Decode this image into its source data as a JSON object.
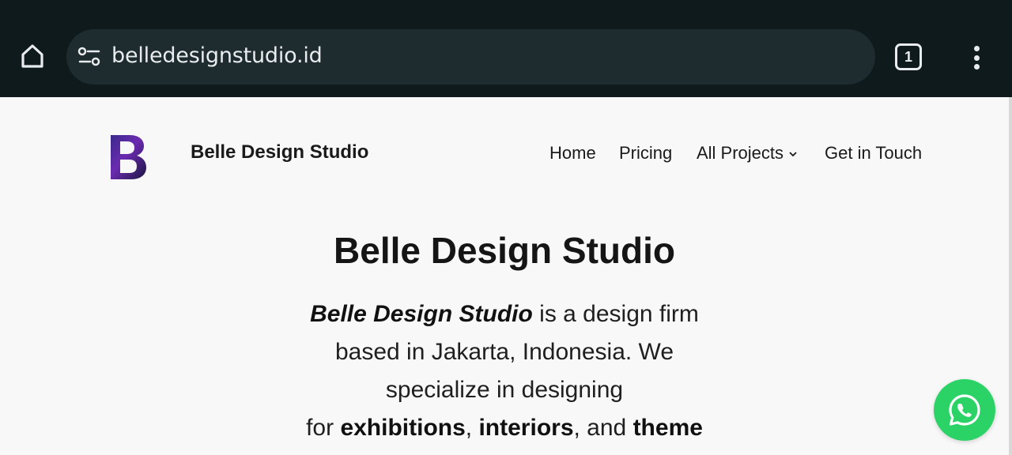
{
  "browser": {
    "url": "belledesignstudio.id",
    "tab_count": "1",
    "home_icon": "home-icon",
    "site_info_icon": "site-settings-icon",
    "menu_icon": "more-vert-icon"
  },
  "header": {
    "logo_letter": "B",
    "site_title": "Belle Design Studio",
    "nav": {
      "home": "Home",
      "pricing": "Pricing",
      "all_projects": "All Projects",
      "get_in_touch": "Get in Touch"
    }
  },
  "hero": {
    "title": "Belle Design Studio",
    "desc_brand": "Belle Design Studio",
    "desc_line1_rest": " is a design firm",
    "desc_line2": "based in Jakarta, Indonesia. We",
    "desc_line3": "specialize in designing",
    "desc_for": "for ",
    "desc_exhibitions": "exhibitions",
    "desc_comma": ", ",
    "desc_interiors": "interiors",
    "desc_and": ", and ",
    "desc_theme": "theme"
  },
  "floating": {
    "whatsapp_icon": "whatsapp-icon"
  },
  "colors": {
    "browser_bar": "#0f1a1d",
    "url_box": "#1e2b2f",
    "page_bg": "#f8f8f8",
    "whatsapp": "#2bd367"
  }
}
